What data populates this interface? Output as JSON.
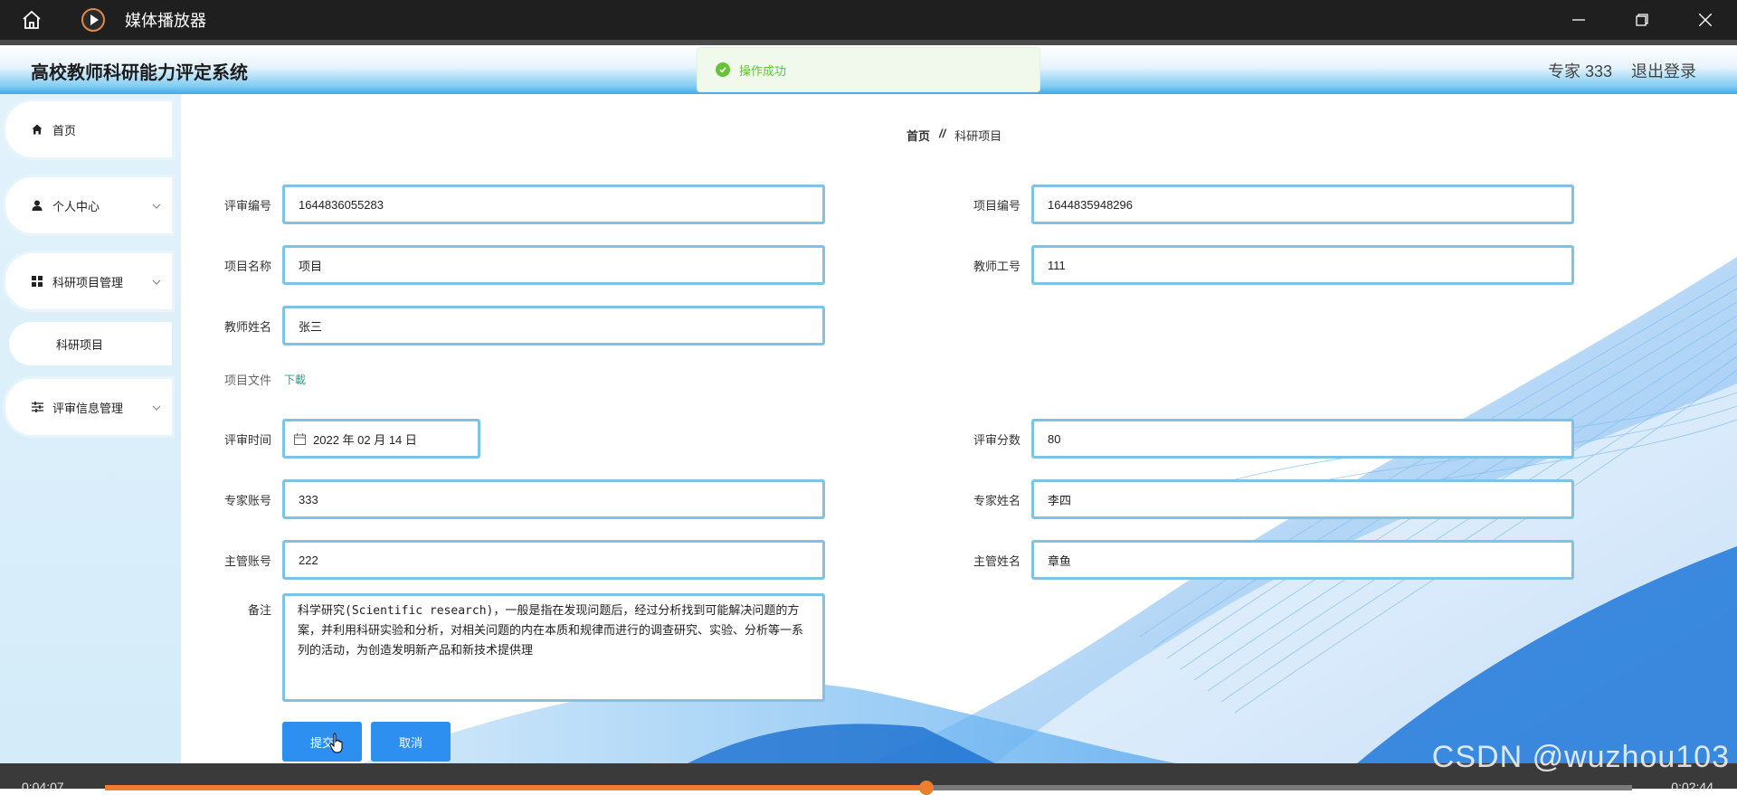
{
  "player": {
    "title": "媒体播放器",
    "current_time": "0:04:07",
    "total_time": "0:02:44",
    "progress": 0.538,
    "accent": "#ee7d2f"
  },
  "app": {
    "system_title": "高校教师科研能力评定系统",
    "user": "专家 333",
    "logout": "退出登录",
    "toast": "操作成功"
  },
  "sidebar": {
    "items": [
      {
        "label": "首页",
        "icon": "home-icon"
      },
      {
        "label": "个人中心",
        "icon": "user-icon"
      },
      {
        "label": "科研项目管理",
        "icon": "grid-icon"
      },
      {
        "label": "评审信息管理",
        "icon": "sliders-icon"
      }
    ],
    "sub_items": [
      {
        "label": "科研项目"
      }
    ]
  },
  "breadcrumb": {
    "home": "首页",
    "separator": "//",
    "current": "科研项目"
  },
  "form": {
    "review_no": {
      "label": "评审编号",
      "value": "1644836055283"
    },
    "project_no": {
      "label": "项目编号",
      "value": "1644835948296"
    },
    "project_name": {
      "label": "项目名称",
      "value": "项目"
    },
    "teacher_id": {
      "label": "教师工号",
      "value": "111"
    },
    "teacher_name": {
      "label": "教师姓名",
      "value": "张三"
    },
    "project_file": {
      "label": "项目文件",
      "link": "下載"
    },
    "review_time": {
      "label": "评审时间",
      "value": "2022 年 02 月 14 日"
    },
    "score": {
      "label": "评审分数",
      "value": "80"
    },
    "expert_account": {
      "label": "专家账号",
      "value": "333"
    },
    "expert_name": {
      "label": "专家姓名",
      "value": "李四"
    },
    "manager_account": {
      "label": "主管账号",
      "value": "222"
    },
    "manager_name": {
      "label": "主管姓名",
      "value": "章鱼"
    },
    "remark": {
      "label": "备注",
      "value": "科学研究(Scientific research)，一般是指在发现问题后，经过分析找到可能解决问题的方案，并利用科研实验和分析，对相关问题的内在本质和规律而进行的调查研究、实验、分析等一系列的活动，为创造发明新产品和新技术提供理"
    },
    "submit": "提交",
    "cancel": "取消"
  },
  "watermark": "CSDN @wuzhou103"
}
